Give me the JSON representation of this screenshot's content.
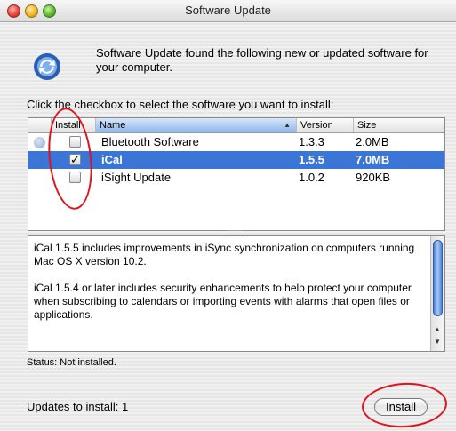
{
  "window": {
    "title": "Software Update"
  },
  "header": {
    "icon": "software-update-icon",
    "message": "Software Update found the following new or updated software for your computer."
  },
  "instruction": "Click the checkbox to select the software you want to install:",
  "table": {
    "columns": {
      "install": "Install",
      "name": "Name",
      "version": "Version",
      "size": "Size"
    },
    "sorted_by": "Name",
    "rows": [
      {
        "name": "Bluetooth Software",
        "version": "1.3.3",
        "size": "2.0MB",
        "checked": false,
        "selected": false
      },
      {
        "name": "iCal",
        "version": "1.5.5",
        "size": "7.0MB",
        "checked": true,
        "selected": true
      },
      {
        "name": "iSight Update",
        "version": "1.0.2",
        "size": "920KB",
        "checked": false,
        "selected": false
      }
    ]
  },
  "details": {
    "paragraph1": "iCal 1.5.5 includes improvements in iSync synchronization on computers running Mac OS X version 10.2.",
    "paragraph2": "iCal 1.5.4 or later includes security enhancements to help protect your computer when subscribing to calendars or importing events with alarms that open files or applications."
  },
  "status": "Status: Not installed.",
  "updates_to_install": "Updates to install: 1",
  "install_button": "Install",
  "colors": {
    "selection": "#3b75d6",
    "annotation": "#e0121b"
  }
}
